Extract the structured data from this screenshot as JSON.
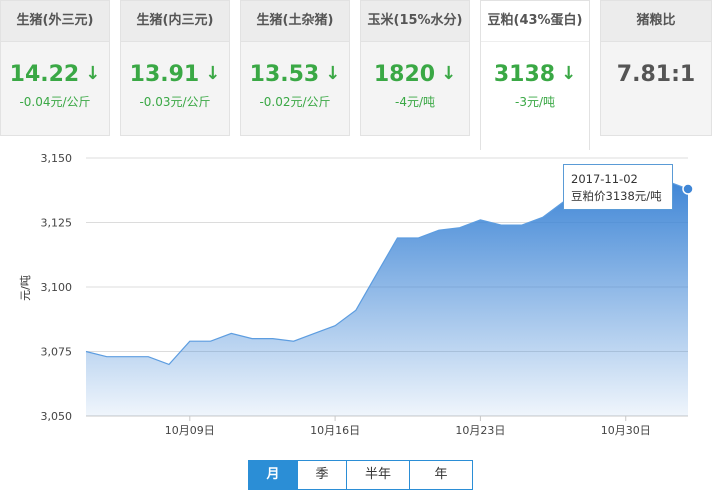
{
  "cards": [
    {
      "title": "生猪(外三元)",
      "price": "14.22",
      "arrow": "↓",
      "change": "-0.04元/公斤"
    },
    {
      "title": "生猪(内三元)",
      "price": "13.91",
      "arrow": "↓",
      "change": "-0.03元/公斤"
    },
    {
      "title": "生猪(土杂猪)",
      "price": "13.53",
      "arrow": "↓",
      "change": "-0.02元/公斤"
    },
    {
      "title": "玉米(15%水分)",
      "price": "1820",
      "arrow": "↓",
      "change": "-4元/吨"
    },
    {
      "title": "豆粕(43%蛋白)",
      "price": "3138",
      "arrow": "↓",
      "change": "-3元/吨"
    },
    {
      "title": "猪粮比",
      "price": "7.81:1"
    }
  ],
  "colors": {
    "down": "#3aa845",
    "line": "#4a8fd8",
    "accent": "#2b8ed6"
  },
  "chart_data": {
    "type": "area",
    "ylabel": "元/吨",
    "ylim": [
      3050,
      3150
    ],
    "yticks": [
      "3,150",
      "3,125",
      "3,100",
      "3,075",
      "3,050"
    ],
    "ytick_values": [
      3150,
      3125,
      3100,
      3075,
      3050
    ],
    "x": [
      "2017-10-04",
      "2017-10-05",
      "2017-10-06",
      "2017-10-07",
      "2017-10-08",
      "2017-10-09",
      "2017-10-10",
      "2017-10-11",
      "2017-10-12",
      "2017-10-13",
      "2017-10-14",
      "2017-10-15",
      "2017-10-16",
      "2017-10-17",
      "2017-10-18",
      "2017-10-19",
      "2017-10-20",
      "2017-10-21",
      "2017-10-22",
      "2017-10-23",
      "2017-10-24",
      "2017-10-25",
      "2017-10-26",
      "2017-10-27",
      "2017-10-28",
      "2017-10-29",
      "2017-10-30",
      "2017-10-31",
      "2017-11-01",
      "2017-11-02"
    ],
    "values": [
      3075,
      3073,
      3073,
      3073,
      3070,
      3079,
      3079,
      3082,
      3080,
      3080,
      3079,
      3082,
      3085,
      3091,
      3105,
      3119,
      3119,
      3122,
      3123,
      3126,
      3124,
      3124,
      3127,
      3133,
      3140,
      3140,
      3140,
      3140,
      3141,
      3138
    ],
    "xtick_labels": [
      "10月09日",
      "10月16日",
      "10月23日",
      "10月30日"
    ],
    "xtick_dates": [
      "2017-10-09",
      "2017-10-16",
      "2017-10-23",
      "2017-10-30"
    ],
    "grid": true,
    "tooltip": {
      "date": "2017-11-02",
      "text": "豆粕价3138元/吨"
    }
  },
  "periods": [
    "月",
    "季",
    "半年",
    "年"
  ]
}
